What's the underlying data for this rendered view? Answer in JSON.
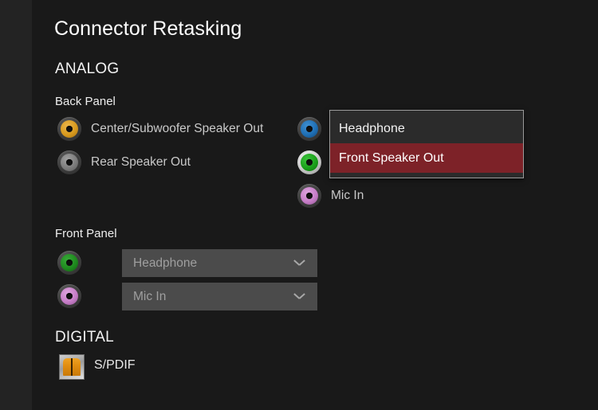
{
  "page": {
    "title": "Connector Retasking",
    "sections": {
      "analog": "ANALOG",
      "digital": "DIGITAL"
    },
    "subheads": {
      "back_panel": "Back Panel",
      "front_panel": "Front Panel"
    }
  },
  "back_panel": {
    "left_column": [
      {
        "label": "Center/Subwoofer Speaker Out",
        "jack_color": "#d89a1e",
        "jack_icon": "audio-jack-icon",
        "highlighted": false
      },
      {
        "label": "Rear Speaker Out",
        "jack_color": "#7d7d7d",
        "jack_icon": "audio-jack-icon",
        "highlighted": false
      }
    ],
    "right_column": [
      {
        "label": "",
        "jack_color": "#1f6fb5",
        "jack_icon": "audio-jack-icon",
        "highlighted": false
      },
      {
        "label": "",
        "jack_color": "#1aa01a",
        "jack_icon": "audio-jack-icon",
        "highlighted": true
      },
      {
        "label": "Mic In",
        "jack_color": "#c77ec8",
        "jack_icon": "audio-jack-icon",
        "highlighted": false
      }
    ]
  },
  "front_panel": {
    "rows": [
      {
        "value": "Headphone",
        "jack_color": "#1f8a1f",
        "jack_icon": "audio-jack-icon",
        "chevron": "chevron-down-icon"
      },
      {
        "value": "Mic In",
        "jack_color": "#c77ec8",
        "jack_icon": "audio-jack-icon",
        "chevron": "chevron-down-icon"
      }
    ]
  },
  "digital": {
    "spdif_label": "S/PDIF",
    "spdif_icon": "spdif-optical-port-icon"
  },
  "dropdown": {
    "items": [
      {
        "label": "Headphone",
        "selected": false
      },
      {
        "label": "Front Speaker Out",
        "selected": true
      }
    ],
    "highlight_color": "#7d2228"
  }
}
